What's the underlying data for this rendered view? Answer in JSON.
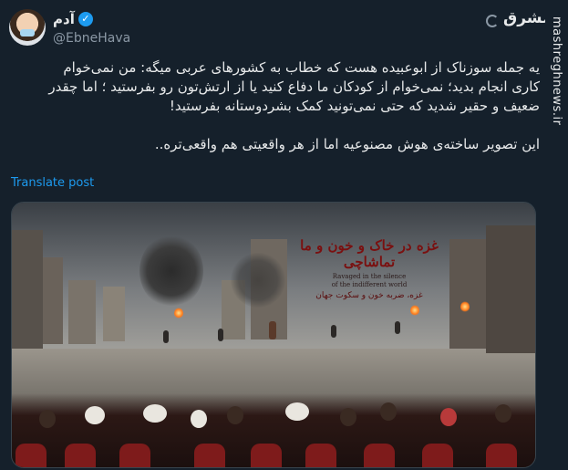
{
  "tweet": {
    "display_name": "آدم",
    "handle": "@EbneHava",
    "verified_icon": "verified-badge-icon",
    "body_lines": [
      "یه جمله سوزناک از ابوعبیده هست که خطاب به کشورهای عربی میگه: من نمی‌خوام",
      "کاری انجام بدید؛ نمی‌خوام از کودکان ما دفاع کنید یا از ارتش‌تون رو بفرستید ؛ اما چقدر",
      "ضعیف و حقیر شدید که حتی نمی‌تونید کمک بشردوستانه بفرستید!"
    ],
    "body_line_2": "این تصویر ساخته‌ی هوش مصنوعیه اما از هر واقعیتی هم واقعی‌تره..",
    "translate_label": "Translate post"
  },
  "source_logo": {
    "text": "مشرق",
    "icon": "mashregh-logo-icon"
  },
  "media": {
    "title_fa": "غزه در خاک و خون و ما تماشاچی",
    "title_en_line1": "Ravaged in the silence",
    "title_en_line2": "of the indifferent world",
    "title_fa_sub": "غزه، ضربه خون و سکوت جهان"
  },
  "watermark": "mashreghnews.ir",
  "colors": {
    "background": "#15202b",
    "text": "#e7e9ea",
    "muted": "#8b98a5",
    "accent": "#1d9bf0"
  }
}
